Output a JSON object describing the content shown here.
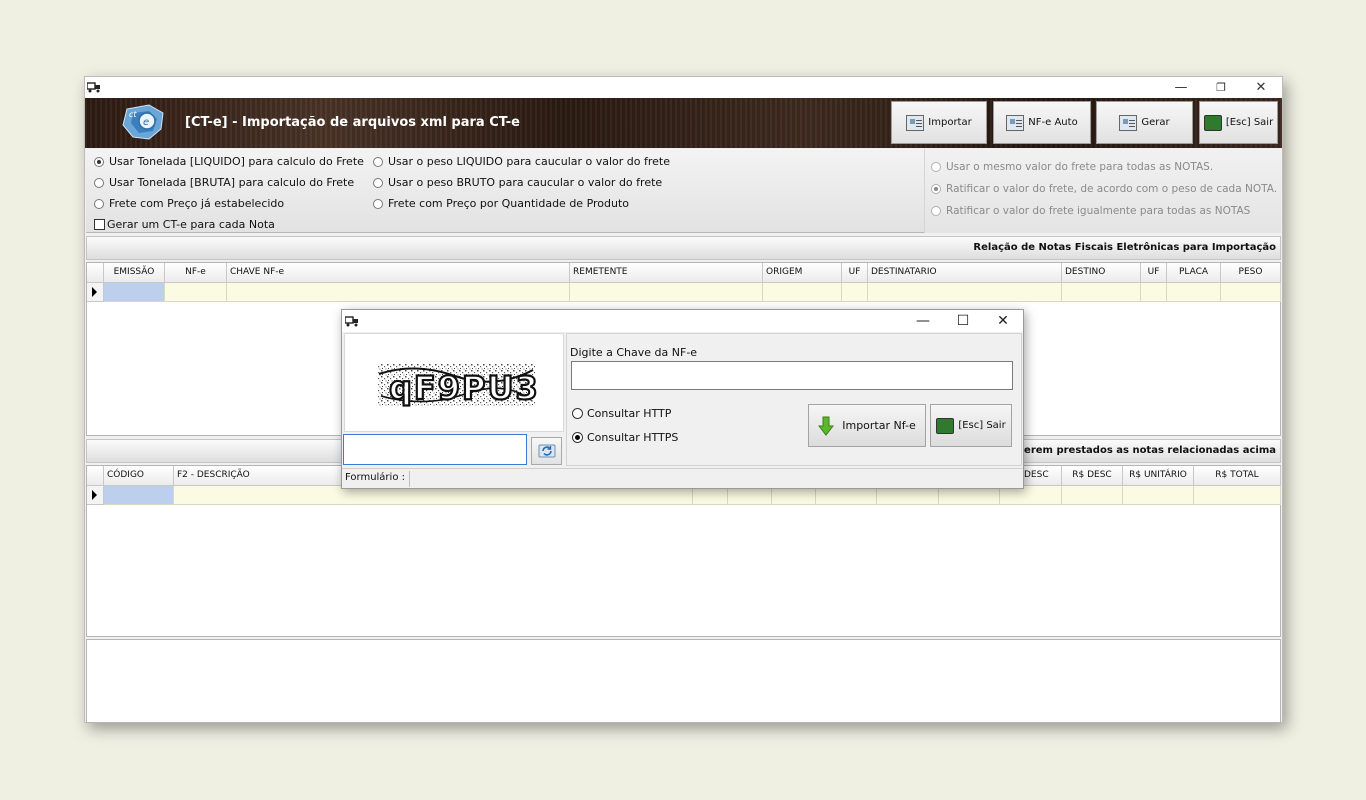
{
  "window": {
    "title": "[CT-e] - Importação de arquivos xml para CT-e",
    "controls": {
      "minimize": "—",
      "maximize": "❐",
      "close": "✕"
    }
  },
  "toolbar": {
    "importar": "Importar",
    "nfe_auto": "NF-e Auto",
    "gerar": "Gerar",
    "sair": "[Esc] Sair"
  },
  "options": {
    "col1": [
      {
        "label": "Usar Tonelada [LIQUIDO] para calculo do Frete",
        "checked": true
      },
      {
        "label": "Usar Tonelada [BRUTA] para calculo do Frete",
        "checked": false
      },
      {
        "label": "Frete com Preço já estabelecido",
        "checked": false
      }
    ],
    "checkbox": {
      "label": "Gerar um CT-e para cada Nota",
      "checked": false
    },
    "col2": [
      {
        "label": "Usar o peso LIQUIDO para caucular o valor do frete",
        "checked": false
      },
      {
        "label": "Usar o peso BRUTO para caucular o valor do frete",
        "checked": false
      },
      {
        "label": "Frete com Preço por Quantidade de Produto",
        "checked": false
      }
    ],
    "col3": [
      {
        "label": "Usar o mesmo valor do frete para todas as NOTAS.",
        "checked": false
      },
      {
        "label": "Ratificar o valor do frete, de acordo com o peso de cada NOTA.",
        "checked": true
      },
      {
        "label": "Ratificar o valor do frete igualmente para todas as NOTAS",
        "checked": false
      }
    ]
  },
  "notes_section": {
    "title": "Relação de Notas Fiscais Eletrônicas para Importação",
    "columns": [
      "EMISSÃO",
      "NF-e",
      "CHAVE NF-e",
      "REMETENTE",
      "ORIGEM",
      "UF",
      "DESTINATARIO",
      "DESTINO",
      "UF",
      "PLACA",
      "PESO"
    ]
  },
  "services_section": {
    "title": "ços a serem prestados as notas relacionadas acima",
    "columns": [
      "CÓDIGO",
      "F2 - DESCRIÇÃO",
      "DESC",
      "R$ DESC",
      "R$ UNITÁRIO",
      "R$ TOTAL"
    ]
  },
  "dialog": {
    "controls": {
      "minimize": "—",
      "maximize": "☐",
      "close": "✕"
    },
    "captcha_text": "qF9PU3",
    "chave_label": "Digite a Chave da NF-e",
    "chave_value": "",
    "captcha_value": "",
    "radio_http": "Consultar HTTP",
    "radio_https": "Consultar HTTPS",
    "https_selected": true,
    "import_button": "Importar Nf-e",
    "sair_button": "[Esc] Sair",
    "status_label": "Formulário :"
  }
}
